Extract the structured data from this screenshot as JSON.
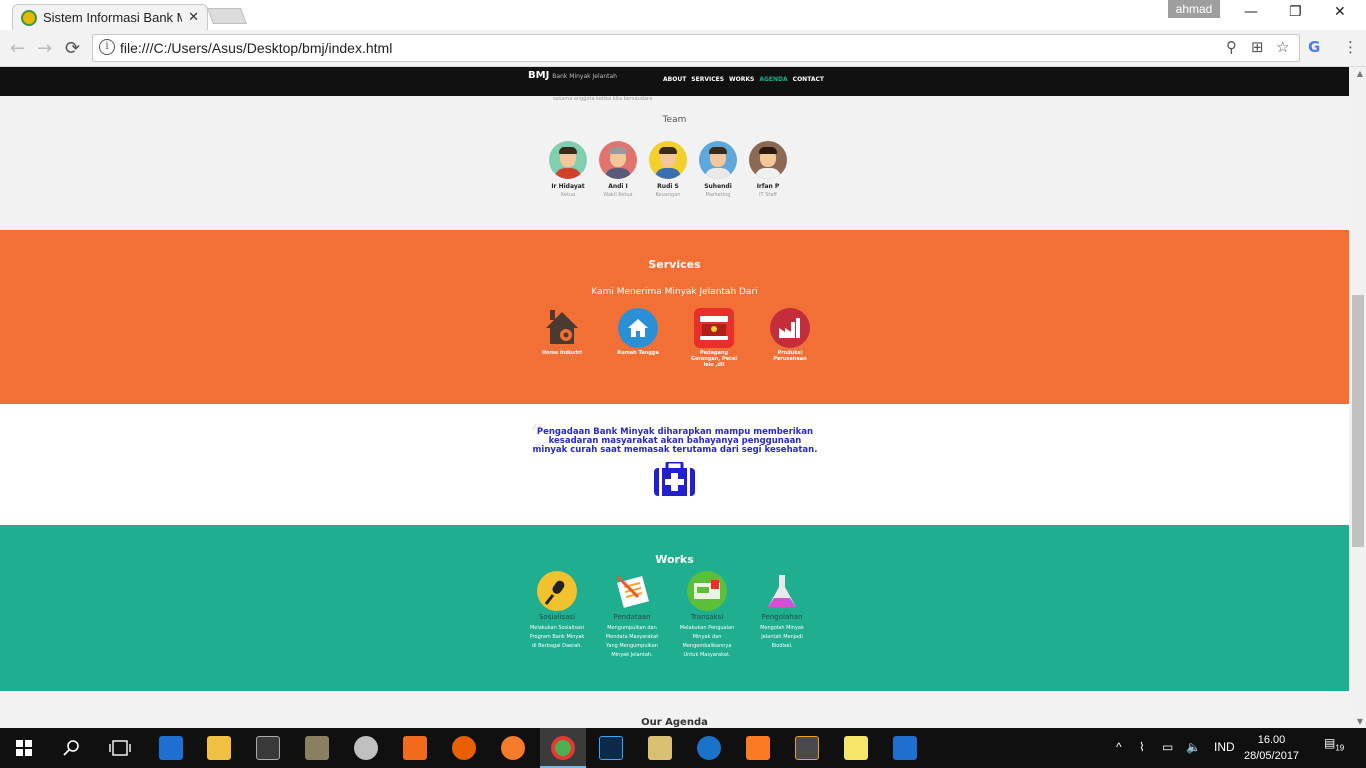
{
  "browser": {
    "tab_title": "Sistem Informasi Bank M",
    "tab_close": "✕",
    "user_name": "ahmad",
    "url": "file:///C:/Users/Asus/Desktop/bmj/index.html",
    "win_min": "—",
    "win_max": "❐",
    "win_close": "✕",
    "back": "←",
    "forward": "→",
    "reload": "⟳",
    "zoom_icon": "⚲",
    "translate_icon": "⊞",
    "star_icon": "☆",
    "ext_icon": "G",
    "menu_icon": "⋮"
  },
  "site": {
    "brand": "BMJ",
    "brand_sub": "Bank Minyak Jelantah",
    "menu": [
      "ABOUT",
      "SERVICES",
      "WORKS",
      "AGENDA",
      "CONTACT"
    ],
    "about_tail": "sesama anggota ketika kita bersaudara",
    "team_title": "Team",
    "team": [
      {
        "name": "Ir Hidayat",
        "role": "Ketua"
      },
      {
        "name": "Andi I",
        "role": "Wakil Ketua"
      },
      {
        "name": "Rudi S",
        "role": "Keuangan"
      },
      {
        "name": "Suhendi",
        "role": "Marketing"
      },
      {
        "name": "Irfan P",
        "role": "IT Staff"
      }
    ],
    "services_title": "Services",
    "services_sub": "Kami Menerima Minyak Jelantah Dari",
    "services": [
      {
        "label": "Home Industri"
      },
      {
        "label": "Rumah Tangga"
      },
      {
        "label": "Pedagang Gorengan, Pecel lele ,dll"
      },
      {
        "label": "Produksi Perusahaan"
      }
    ],
    "quote": "Pengadaan Bank Minyak diharapkan mampu memberikan kesadaran masyarakat akan bahayanya penggunaan minyak curah saat memasak terutama dari segi kesehatan.",
    "works_title": "Works",
    "works": [
      {
        "title": "Sosialisasi",
        "desc": "Melakukan Sosialisasi Program Bank Minyak di Berbagai Daerah."
      },
      {
        "title": "Pendataan",
        "desc": "Mengumpulkan dan Mendata Masyarakat Yang Mengumpulkan Minyak Jelantah."
      },
      {
        "title": "Transaksi",
        "desc": "Melakukan Pengualan Minyak dan Mengembalikannya Untuk Masyarakat."
      },
      {
        "title": "Pengolahan",
        "desc": "Mengolah Minyak Jelantah Menjadi Biodisel."
      }
    ],
    "agenda_title": "Our Agenda"
  },
  "taskbar": {
    "lang": "IND",
    "time": "16.00",
    "date": "28/05/2017",
    "notif_count": "19"
  },
  "colors": {
    "services_bg": "#f27035",
    "works_bg": "#1fae8f",
    "quote_text": "#2929c7",
    "navbar_bg": "#111111",
    "menu_active": "#1fae8f"
  }
}
